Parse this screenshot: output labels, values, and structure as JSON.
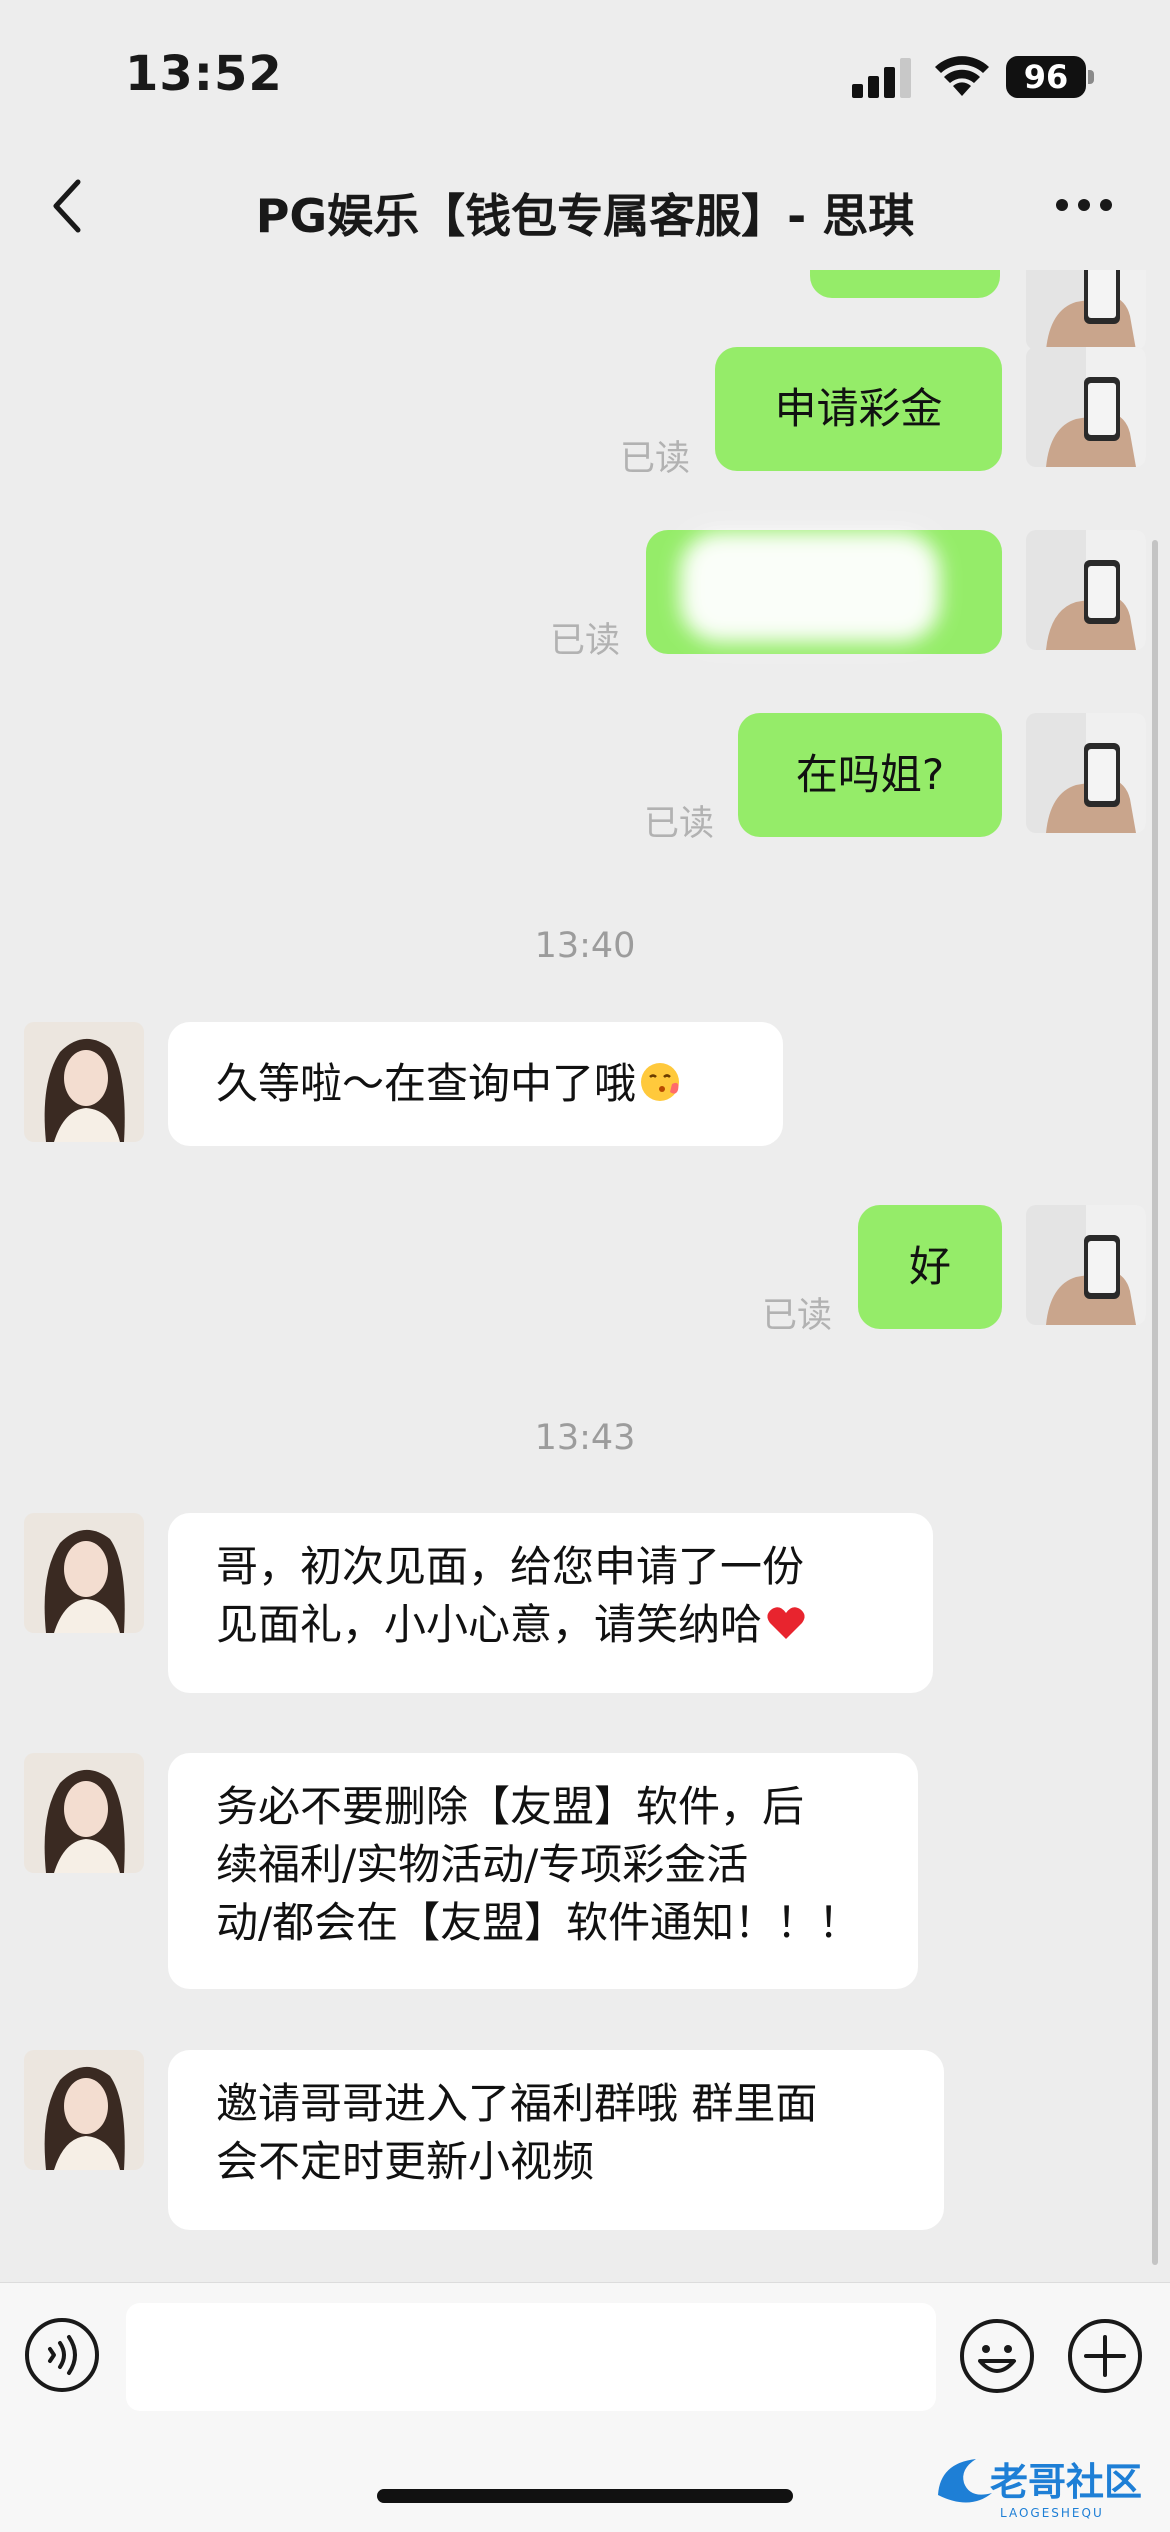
{
  "status_bar": {
    "time": "13:52",
    "battery": "96",
    "icons": [
      "signal-icon",
      "wifi-icon",
      "battery-icon"
    ]
  },
  "nav": {
    "title": "PG娱乐【钱包专属客服】- 思琪",
    "back_icon": "chevron-left-icon",
    "more_icon": "more-dots-icon"
  },
  "messages": [
    {
      "type": "outgoing",
      "text": "申请彩金",
      "read": "已读"
    },
    {
      "type": "outgoing",
      "text": "",
      "redacted": true,
      "read": "已读"
    },
    {
      "type": "outgoing",
      "text": "在吗姐?",
      "read": "已读"
    },
    {
      "type": "timestamp",
      "text": "13:40"
    },
    {
      "type": "incoming",
      "lines": [
        "久等啦～在查询中了哦"
      ],
      "emoji": "kissing-face-icon"
    },
    {
      "type": "outgoing",
      "text": "好",
      "read": "已读"
    },
    {
      "type": "timestamp",
      "text": "13:43"
    },
    {
      "type": "incoming",
      "lines": [
        "哥，初次见面，给您申请了一份",
        "见面礼，小小心意，请笑纳哈"
      ],
      "emoji": "red-heart-icon"
    },
    {
      "type": "incoming",
      "lines": [
        "务必不要删除【友盟】软件，后",
        "续福利/实物活动/专项彩金活",
        "动/都会在【友盟】软件通知！！！"
      ]
    },
    {
      "type": "incoming",
      "lines": [
        "邀请哥哥进入了福利群哦 群里面",
        "会不定时更新小视频"
      ]
    }
  ],
  "input_bar": {
    "placeholder": "",
    "voice_icon": "voice-icon",
    "emoji_icon": "emoji-icon",
    "plus_icon": "plus-icon"
  },
  "watermark": {
    "text": "老哥社区",
    "subtext": "LAOGESHEQU"
  },
  "colors": {
    "background": "#ededed",
    "outgoing_bubble": "#95ec69",
    "incoming_bubble": "#ffffff",
    "read_status": "#b2b2b2"
  }
}
